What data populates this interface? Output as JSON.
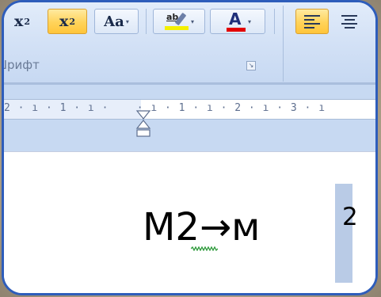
{
  "ribbon": {
    "subscript_label": "x",
    "subscript_suffix": "2",
    "superscript_label": "x",
    "superscript_suffix": "2",
    "change_case_label": "Aa",
    "highlight_label": "ab",
    "font_color_label": "A",
    "group_label": "Шрифт",
    "dropdown_arrow": "▾",
    "launcher_icon": "dialog-launcher-icon"
  },
  "ruler": {
    "ticks_text": "2 · ı · 1 · ı ·    · ı · 1 · ı · 2 · ı · 3 · ı"
  },
  "document": {
    "formula_base": "M2→м",
    "formula_superscript": "2"
  },
  "colors": {
    "frame": "#2e5dbb",
    "active_button": "#ffd35a",
    "highlight": "#f4f000",
    "font_color": "#e30000",
    "selection": "#b9cbe6"
  }
}
